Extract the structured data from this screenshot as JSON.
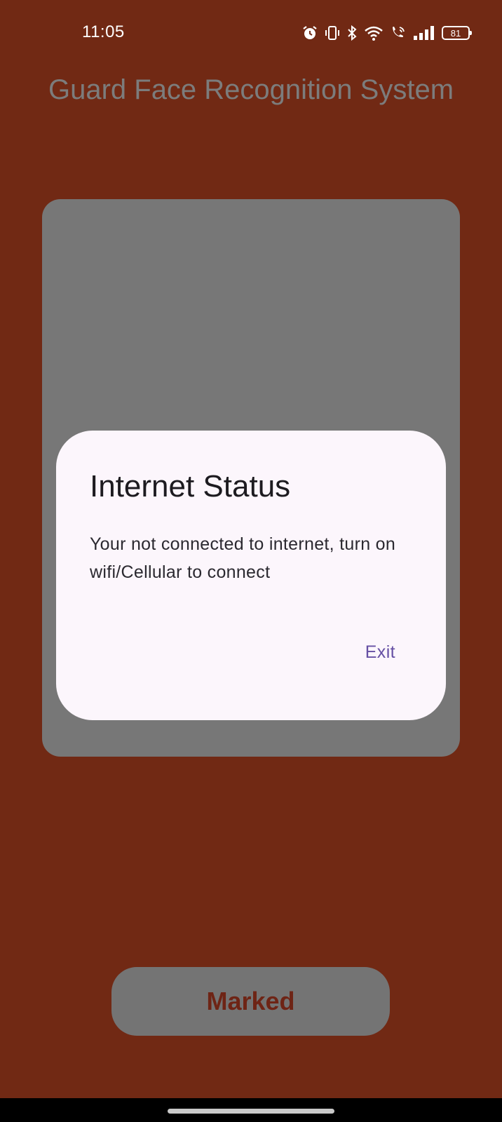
{
  "status_bar": {
    "time": "11:05",
    "icons": [
      "alarm-icon",
      "vibrate-icon",
      "bluetooth-icon",
      "wifi-icon",
      "wifi-calling-icon",
      "signal-icon"
    ],
    "battery_level": "81"
  },
  "app": {
    "title": "Guard Face Recognition System"
  },
  "dialog": {
    "title": "Internet Status",
    "message": "Your not connected to internet, turn on wifi/Cellular to connect",
    "exit_label": "Exit"
  },
  "action": {
    "marked_label": "Marked"
  },
  "colors": {
    "background": "#712914",
    "overlay_gray": "#777777",
    "dialog_surface": "#fcf6fc",
    "dialog_action": "#6650a4",
    "button_text": "#6e2415"
  }
}
